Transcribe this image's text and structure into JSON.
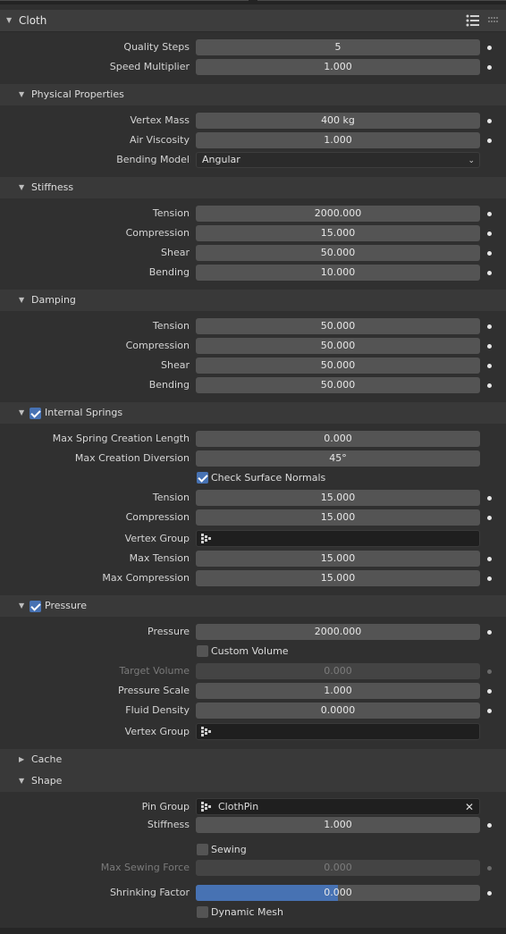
{
  "panel": {
    "title": "Cloth"
  },
  "general": {
    "quality_steps": {
      "label": "Quality Steps",
      "value": "5"
    },
    "speed_multiplier": {
      "label": "Speed Multiplier",
      "value": "1.000"
    }
  },
  "physical": {
    "title": "Physical Properties",
    "vertex_mass": {
      "label": "Vertex Mass",
      "value": "400 kg"
    },
    "air_viscosity": {
      "label": "Air Viscosity",
      "value": "1.000"
    },
    "bending_model": {
      "label": "Bending Model",
      "value": "Angular"
    }
  },
  "stiffness": {
    "title": "Stiffness",
    "tension": {
      "label": "Tension",
      "value": "2000.000"
    },
    "compression": {
      "label": "Compression",
      "value": "15.000"
    },
    "shear": {
      "label": "Shear",
      "value": "50.000"
    },
    "bending": {
      "label": "Bending",
      "value": "10.000"
    }
  },
  "damping": {
    "title": "Damping",
    "tension": {
      "label": "Tension",
      "value": "50.000"
    },
    "compression": {
      "label": "Compression",
      "value": "50.000"
    },
    "shear": {
      "label": "Shear",
      "value": "50.000"
    },
    "bending": {
      "label": "Bending",
      "value": "50.000"
    }
  },
  "internal_springs": {
    "title": "Internal Springs",
    "enabled": true,
    "max_spring_length": {
      "label": "Max Spring Creation Length",
      "value": "0.000"
    },
    "max_diversion": {
      "label": "Max Creation Diversion",
      "value": "45°"
    },
    "check_normals": {
      "label": "Check Surface Normals",
      "checked": true
    },
    "tension": {
      "label": "Tension",
      "value": "15.000"
    },
    "compression": {
      "label": "Compression",
      "value": "15.000"
    },
    "vertex_group": {
      "label": "Vertex Group",
      "value": ""
    },
    "max_tension": {
      "label": "Max Tension",
      "value": "15.000"
    },
    "max_compression": {
      "label": "Max Compression",
      "value": "15.000"
    }
  },
  "pressure": {
    "title": "Pressure",
    "enabled": true,
    "pressure": {
      "label": "Pressure",
      "value": "2000.000"
    },
    "custom_volume": {
      "label": "Custom Volume",
      "checked": false
    },
    "target_volume": {
      "label": "Target Volume",
      "value": "0.000"
    },
    "pressure_scale": {
      "label": "Pressure Scale",
      "value": "1.000"
    },
    "fluid_density": {
      "label": "Fluid Density",
      "value": "0.0000"
    },
    "vertex_group": {
      "label": "Vertex Group",
      "value": ""
    }
  },
  "cache": {
    "title": "Cache"
  },
  "shape": {
    "title": "Shape",
    "pin_group": {
      "label": "Pin Group",
      "value": "ClothPin"
    },
    "stiffness": {
      "label": "Stiffness",
      "value": "1.000"
    },
    "sewing": {
      "label": "Sewing",
      "checked": false
    },
    "max_sewing_force": {
      "label": "Max Sewing Force",
      "value": "0.000"
    },
    "shrinking_factor": {
      "label": "Shrinking Factor",
      "value": "0.000",
      "fill_fraction": 0.5
    },
    "dynamic_mesh": {
      "label": "Dynamic Mesh",
      "checked": false
    }
  },
  "colors": {
    "accent": "#4772b3",
    "background": "#303030",
    "field": "#545454"
  },
  "icons": [
    "list-icon",
    "grip-icon",
    "collapse-triangle-icon",
    "expand-triangle-icon",
    "vertex-group-icon",
    "close-icon",
    "chevron-down-icon"
  ]
}
